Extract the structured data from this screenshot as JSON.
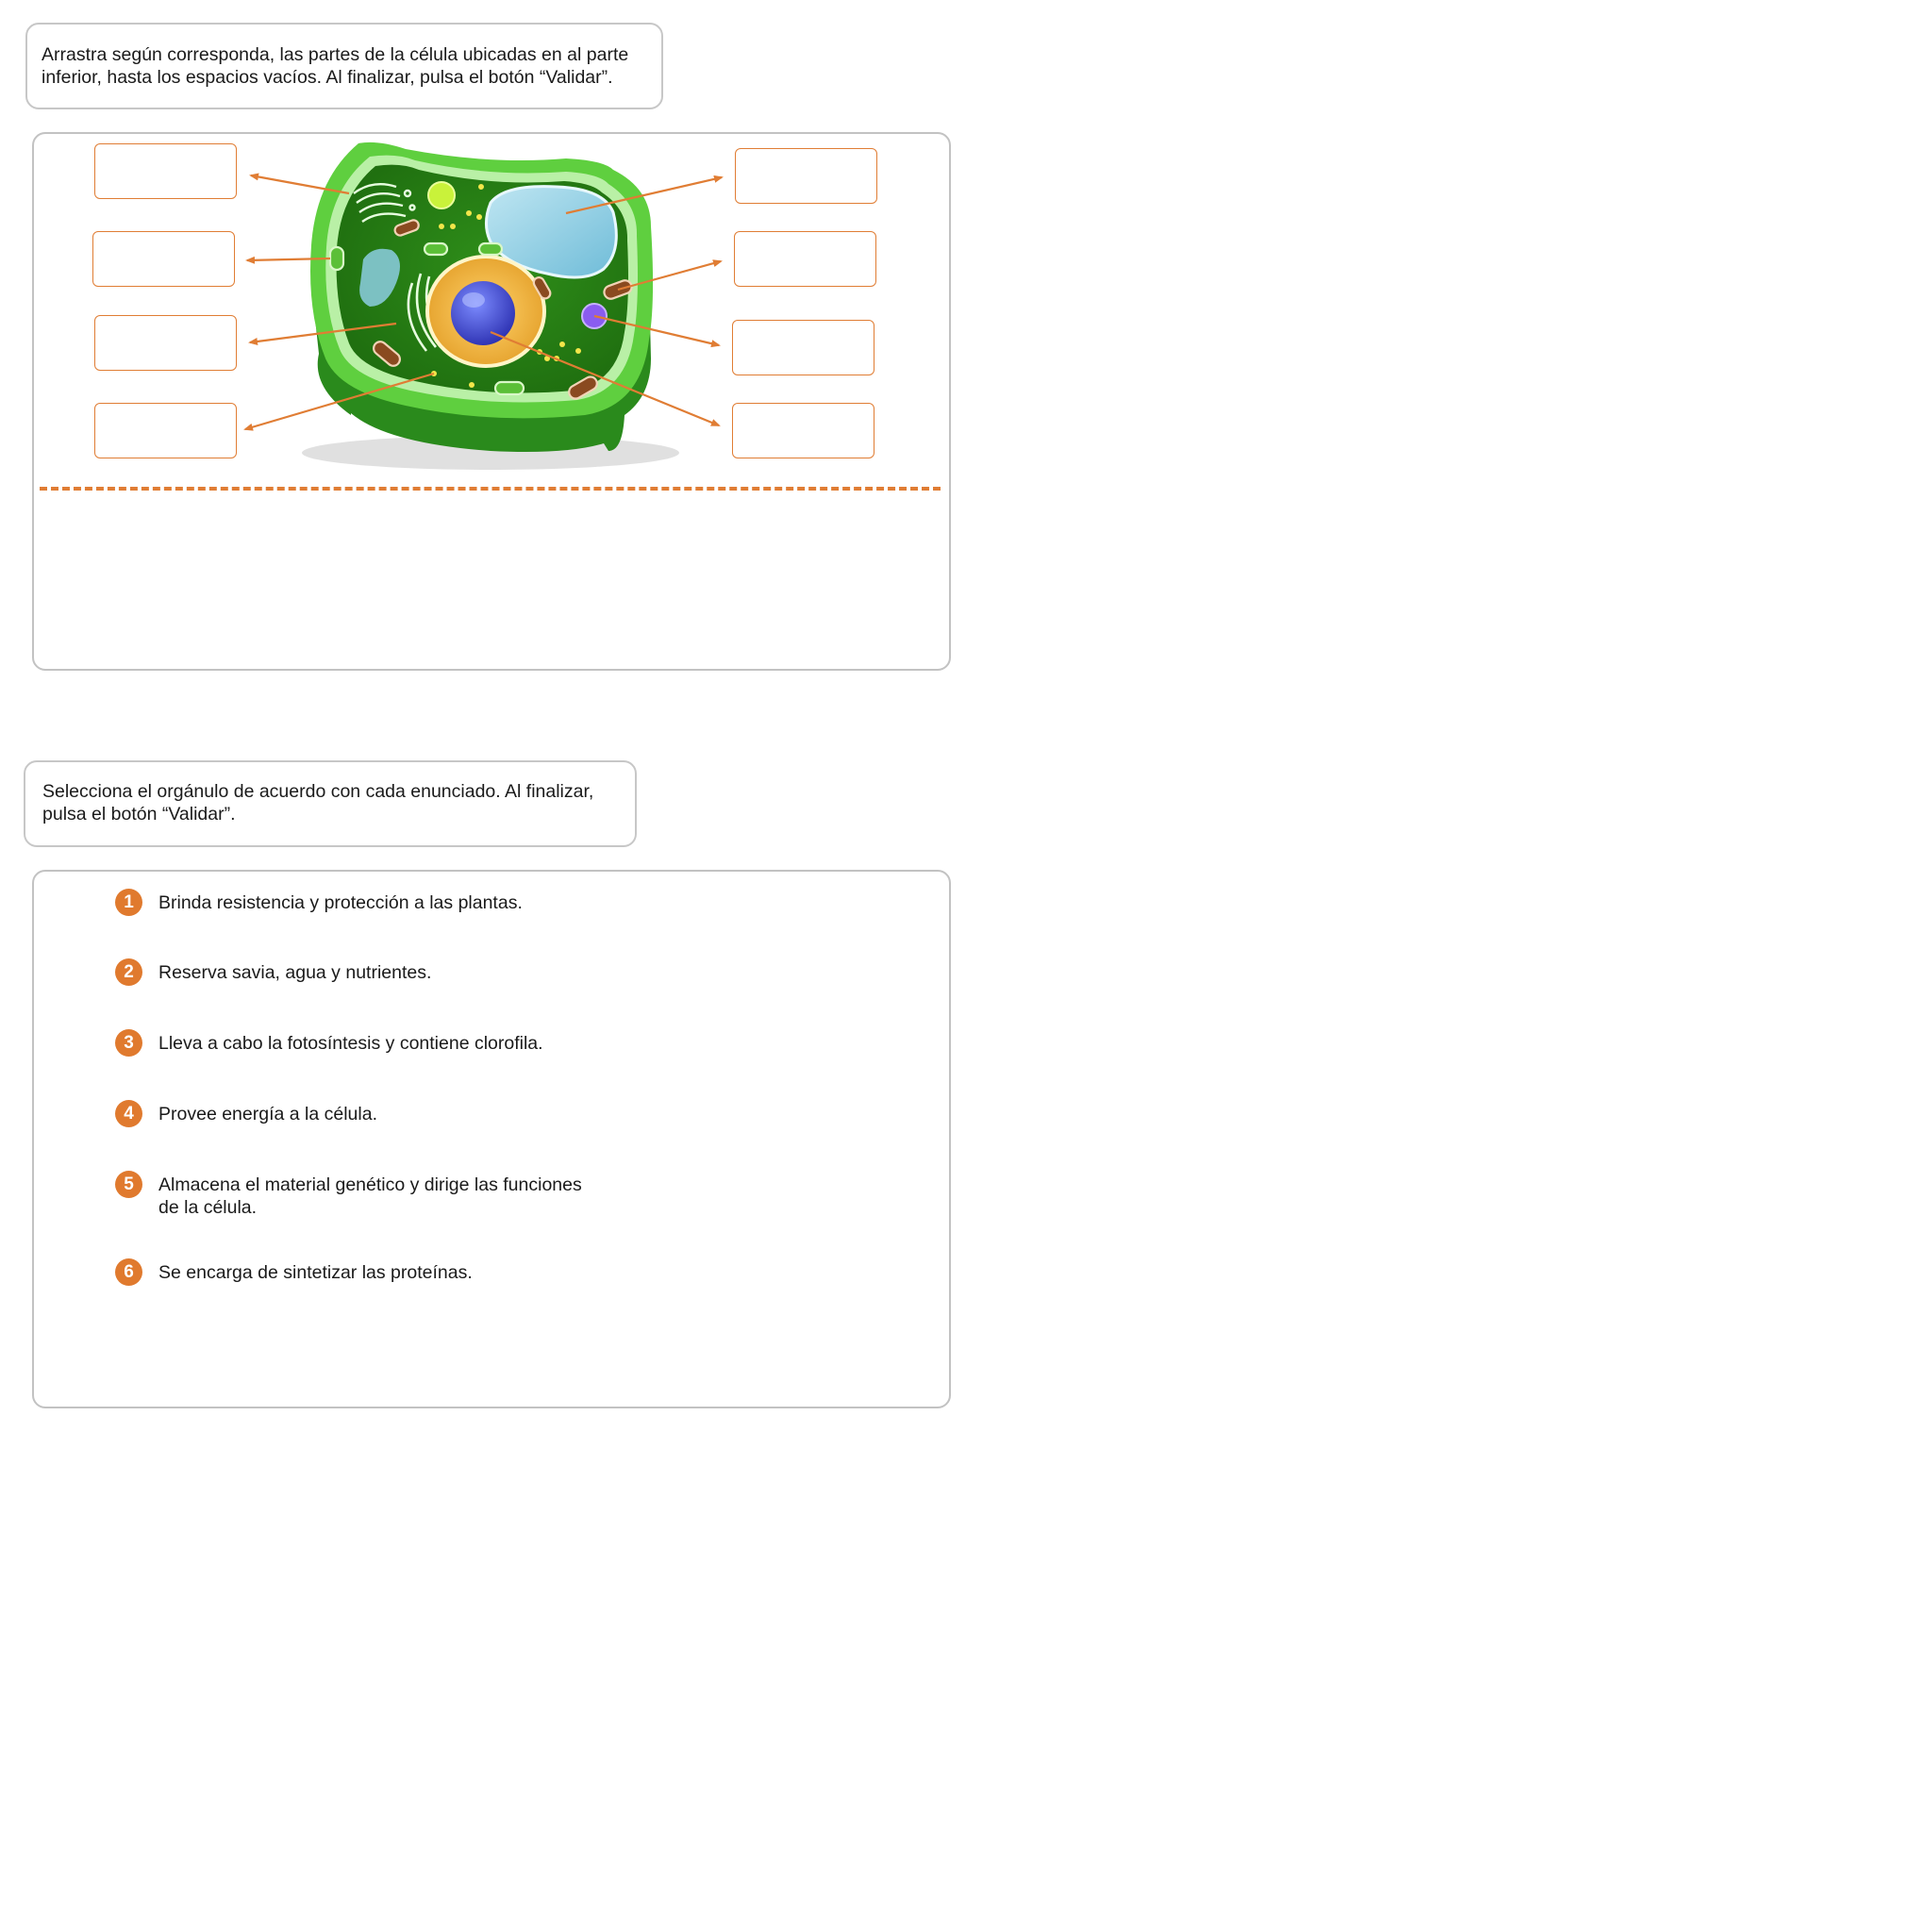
{
  "activity1": {
    "instruction_line1": "Arrastra según corresponda, las partes de la célula ubicadas en al parte",
    "instruction_line2": "inferior, hasta los espacios vacíos. Al finalizar, pulsa el botón “Validar”."
  },
  "activity2": {
    "instruction_line1": "Selecciona el orgánulo de acuerdo con cada enunciado. Al finalizar,",
    "instruction_line2": "pulsa el botón “Validar”.",
    "statements": [
      {
        "number": "1",
        "line1": "Brinda resistencia y protección a las plantas.",
        "line2": ""
      },
      {
        "number": "2",
        "line1": "Reserva savia, agua y nutrientes.",
        "line2": ""
      },
      {
        "number": "3",
        "line1": "Lleva a cabo la fotosíntesis y contiene clorofila.",
        "line2": ""
      },
      {
        "number": "4",
        "line1": "Provee energía a la célula.",
        "line2": ""
      },
      {
        "number": "5",
        "line1": "Almacena el material genético y dirige las funciones",
        "line2": "de la célula."
      },
      {
        "number": "6",
        "line1": "Se encarga de sintetizar las proteínas.",
        "line2": ""
      }
    ]
  },
  "colors": {
    "accent": "#e07d34",
    "number_badge": "#e07a2e",
    "panel_border": "#c2c2c2",
    "cell_green": "#3a9a22"
  }
}
